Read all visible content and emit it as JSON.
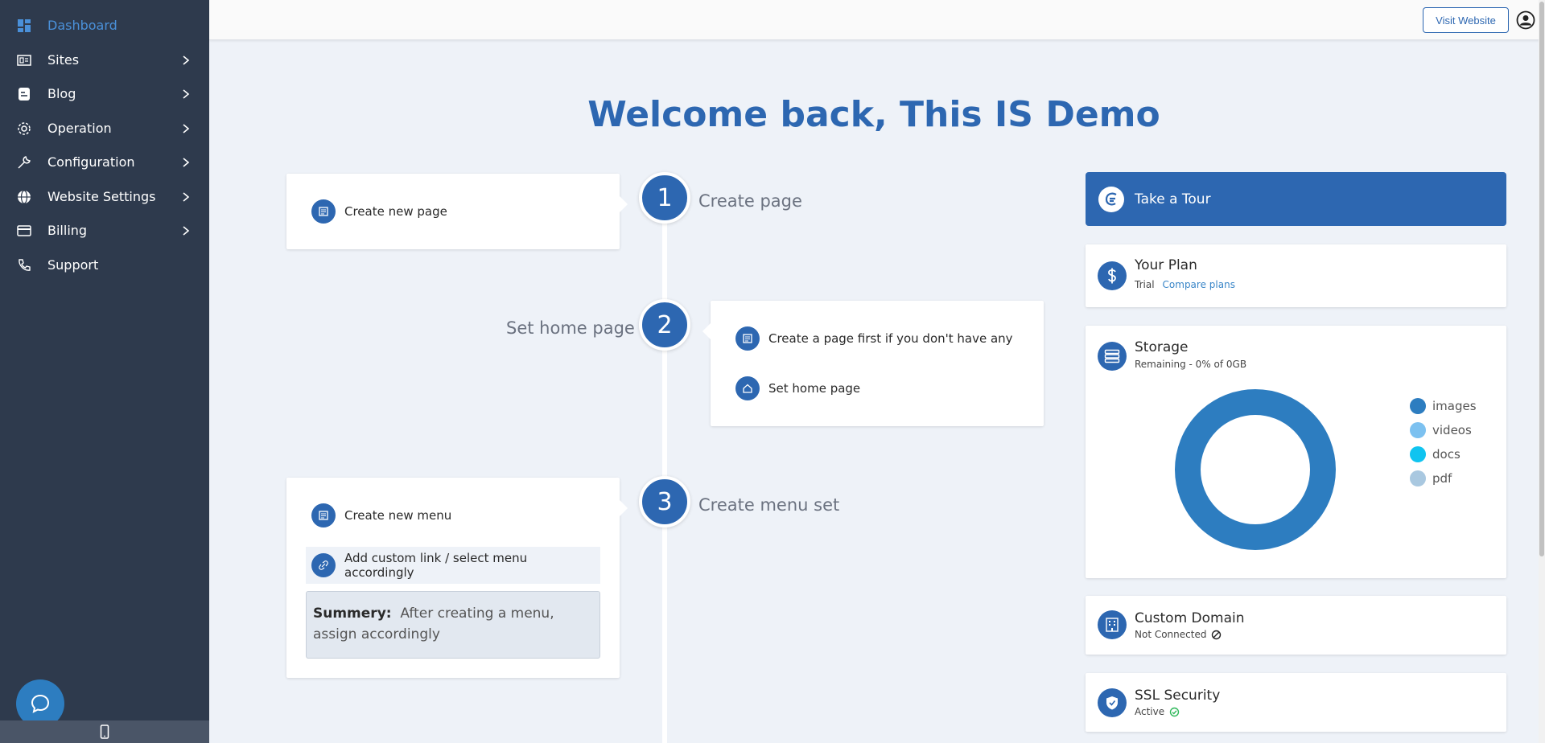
{
  "sidebar": {
    "items": [
      {
        "label": "Dashboard",
        "icon": "dashboard-icon",
        "active": true
      },
      {
        "label": "Sites",
        "icon": "sites-icon"
      },
      {
        "label": "Blog",
        "icon": "blog-icon"
      },
      {
        "label": "Operation",
        "icon": "gear-icon"
      },
      {
        "label": "Configuration",
        "icon": "wrench-icon"
      },
      {
        "label": "Website Settings",
        "icon": "globe-icon"
      },
      {
        "label": "Billing",
        "icon": "credit-card-icon"
      },
      {
        "label": "Support",
        "icon": "phone-icon"
      }
    ]
  },
  "topbar": {
    "visit_label": "Visit Website"
  },
  "main": {
    "welcome": "Welcome back, This IS Demo",
    "steps": [
      {
        "number": "1",
        "title": "Create page",
        "tasks": [
          {
            "label": "Create new page",
            "icon": "page-icon"
          }
        ]
      },
      {
        "number": "2",
        "title": "Set home page",
        "tasks": [
          {
            "label": "Create a page first if you don't have any",
            "icon": "page-icon"
          },
          {
            "label": "Set home page",
            "icon": "home-icon"
          }
        ]
      },
      {
        "number": "3",
        "title": "Create menu set",
        "tasks": [
          {
            "label": "Create new menu",
            "icon": "page-icon"
          },
          {
            "label": "Add custom link / select menu accordingly",
            "icon": "link-icon"
          }
        ],
        "summary_label": "Summery:",
        "summary_text": "After creating a menu, assign accordingly"
      }
    ]
  },
  "widgets": {
    "tour_label": "Take a Tour",
    "plan": {
      "title": "Your Plan",
      "plan_name": "Trial",
      "link": "Compare plans"
    },
    "storage": {
      "title": "Storage",
      "subtitle": "Remaining - 0% of 0GB",
      "legend": [
        "images",
        "videos",
        "docs",
        "pdf"
      ]
    },
    "domain": {
      "title": "Custom Domain",
      "status": "Not Connected"
    },
    "ssl": {
      "title": "SSL Security",
      "status": "Active"
    }
  },
  "colors": {
    "accent": "#2d67b1",
    "sidebar_bg": "#2e3a4d",
    "page_bg": "#eef2f8",
    "legend": [
      "#2d7dc0",
      "#7cc1f0",
      "#10c4f0",
      "#a9c8e0"
    ]
  },
  "chart_data": {
    "type": "pie",
    "categories": [
      "images",
      "videos",
      "docs",
      "pdf"
    ],
    "values": [
      100,
      0,
      0,
      0
    ]
  }
}
